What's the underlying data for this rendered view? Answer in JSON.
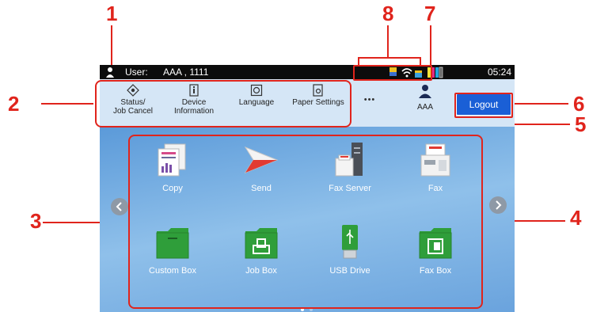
{
  "callouts": [
    "1",
    "2",
    "3",
    "4",
    "5",
    "6",
    "7",
    "8"
  ],
  "status_bar": {
    "user_label": "User:",
    "user_value": "AAA , 1111",
    "time": "05:24"
  },
  "quick_buttons": [
    {
      "label_line1": "Status/",
      "label_line2": "Job Cancel",
      "icon": "eye-diamond-icon"
    },
    {
      "label_line1": "Device",
      "label_line2": "Information",
      "icon": "device-info-icon"
    },
    {
      "label_line1": "Language",
      "label_line2": "",
      "icon": "language-icon"
    },
    {
      "label_line1": "Paper Settings",
      "label_line2": "",
      "icon": "paper-settings-icon"
    }
  ],
  "more_button": "•••",
  "user_button": {
    "label": "AAA",
    "icon": "user-icon"
  },
  "logout_button": "Logout",
  "apps": [
    {
      "label": "Copy",
      "icon": "copy-icon"
    },
    {
      "label": "Send",
      "icon": "send-icon"
    },
    {
      "label": "Fax Server",
      "icon": "fax-server-icon"
    },
    {
      "label": "Fax",
      "icon": "fax-icon"
    },
    {
      "label": "Custom Box",
      "icon": "custom-box-icon"
    },
    {
      "label": "Job Box",
      "icon": "job-box-icon"
    },
    {
      "label": "USB Drive",
      "icon": "usb-drive-icon"
    },
    {
      "label": "Fax Box",
      "icon": "fax-box-icon"
    }
  ],
  "colors": {
    "accent": "#e0241c",
    "logout": "#1a5fd6",
    "folder_green": "#2f9e3a"
  },
  "page_indicator": {
    "current": 1,
    "total": 2
  }
}
